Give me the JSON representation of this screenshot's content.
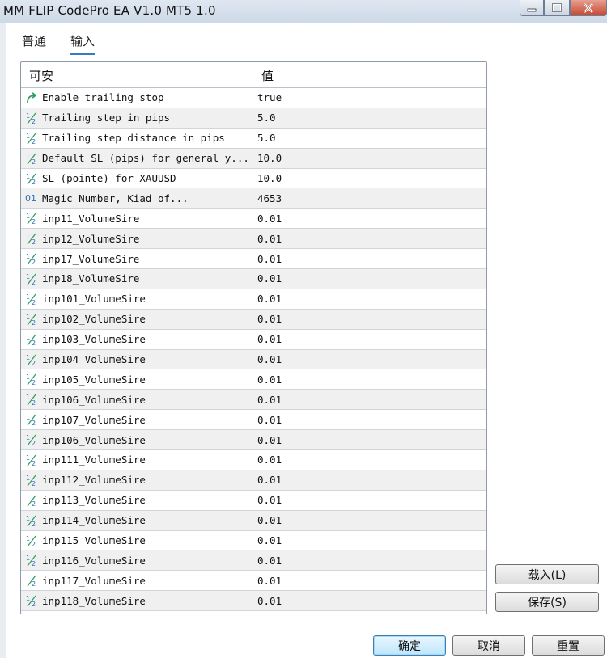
{
  "window": {
    "title": "MM FLIP CodePro EA V1.0 MT5 1.0"
  },
  "tabs": [
    {
      "label": "普通"
    },
    {
      "label": "输入"
    }
  ],
  "grid": {
    "columns": {
      "name": "可安",
      "value": "值"
    },
    "rows": [
      {
        "icon": "bool-arrow-icon",
        "name": "Enable trailing stop",
        "value": "true"
      },
      {
        "icon": "number-icon",
        "name": "Trailing step in pips",
        "value": "5.0"
      },
      {
        "icon": "number-icon",
        "name": "Trailing step distance in pips",
        "value": "5.0"
      },
      {
        "icon": "number-icon",
        "name": "Default SL (pips) for general y...",
        "value": "10.0"
      },
      {
        "icon": "number-icon",
        "name": "SL (pointe) for XAUUSD",
        "value": "10.0"
      },
      {
        "icon": "integer-icon",
        "name": "Magic Number, Kiad of...",
        "value": "4653"
      },
      {
        "icon": "number-icon",
        "name": "inp11_VolumeSire",
        "value": "0.01"
      },
      {
        "icon": "number-icon",
        "name": "inp12_VolumeSire",
        "value": "0.01"
      },
      {
        "icon": "number-icon",
        "name": "inp17_VolumeSire",
        "value": "0.01"
      },
      {
        "icon": "number-icon",
        "name": "inp18_VolumeSire",
        "value": "0.01"
      },
      {
        "icon": "number-icon",
        "name": "inp101_VolumeSire",
        "value": "0.01"
      },
      {
        "icon": "number-icon",
        "name": "inp102_VolumeSire",
        "value": "0.01"
      },
      {
        "icon": "number-icon",
        "name": "inp103_VolumeSire",
        "value": "0.01"
      },
      {
        "icon": "number-icon",
        "name": "inp104_VolumeSire",
        "value": "0.01"
      },
      {
        "icon": "number-icon",
        "name": "inp105_VolumeSire",
        "value": "0.01"
      },
      {
        "icon": "number-icon",
        "name": "inp106_VolumeSire",
        "value": "0.01"
      },
      {
        "icon": "number-icon",
        "name": "inp107_VolumeSire",
        "value": "0.01"
      },
      {
        "icon": "number-icon",
        "name": "inp106_VolumeSire",
        "value": "0.01"
      },
      {
        "icon": "number-icon",
        "name": "inp111_VolumeSire",
        "value": "0.01"
      },
      {
        "icon": "number-icon",
        "name": "inp112_VolumeSire",
        "value": "0.01"
      },
      {
        "icon": "number-icon",
        "name": "inp113_VolumeSire",
        "value": "0.01"
      },
      {
        "icon": "number-icon",
        "name": "inp114_VolumeSire",
        "value": "0.01"
      },
      {
        "icon": "number-icon",
        "name": "inp115_VolumeSire",
        "value": "0.01"
      },
      {
        "icon": "number-icon",
        "name": "inp116_VolumeSire",
        "value": "0.01"
      },
      {
        "icon": "number-icon",
        "name": "inp117_VolumeSire",
        "value": "0.01"
      },
      {
        "icon": "number-icon",
        "name": "inp118_VolumeSire",
        "value": "0.01"
      }
    ]
  },
  "buttons": {
    "load": "载入(L)",
    "save": "保存(S)",
    "ok": "确定",
    "cancel": "取消",
    "reset": "重置"
  },
  "colors": {
    "icon_green": "#2f9e63",
    "icon_blue": "#2b6fb3",
    "tab_underline": "#3a78c8"
  }
}
